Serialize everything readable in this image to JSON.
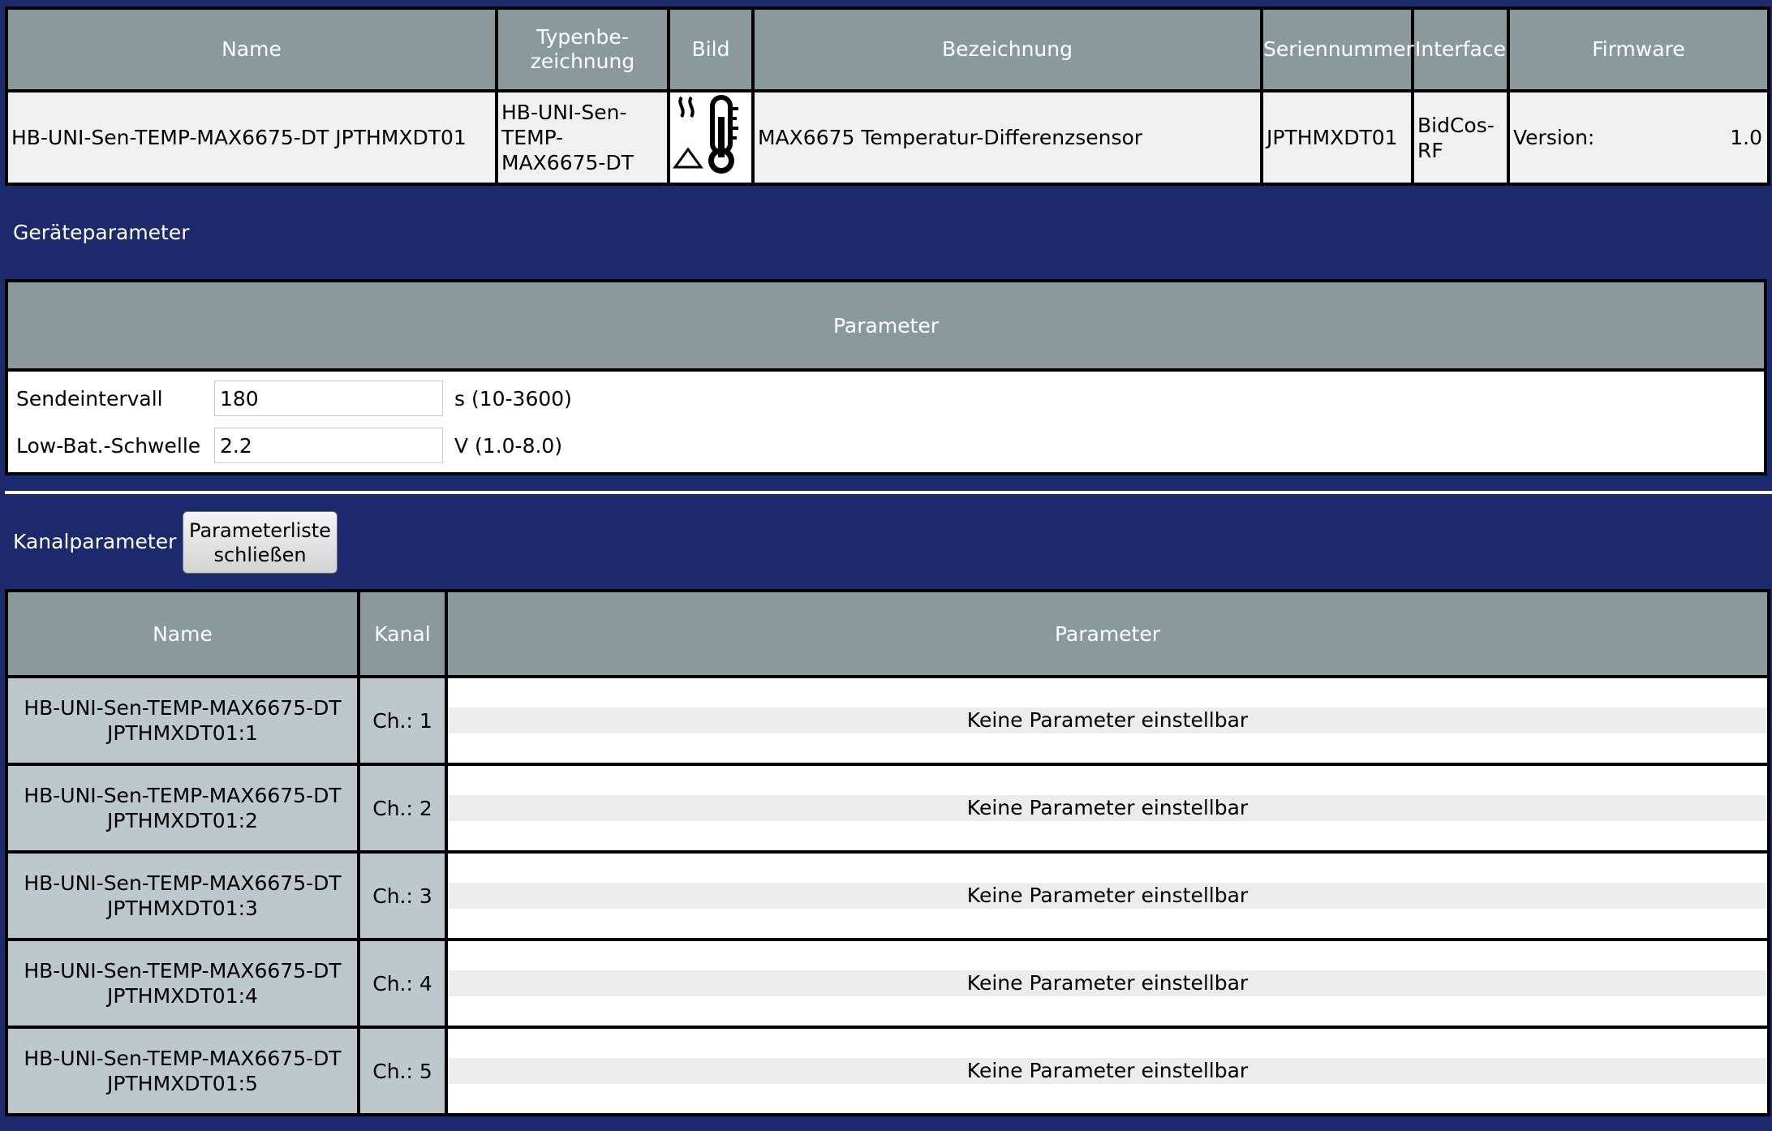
{
  "device": {
    "columns": {
      "name": "Name",
      "type": "Typenbe-\nzeichnung",
      "image": "Bild",
      "description": "Bezeichnung",
      "serial": "Seriennummer",
      "interface": "Interface",
      "firmware": "Firmware"
    },
    "row": {
      "name": "HB-UNI-Sen-TEMP-MAX6675-DT JPTHMXDT01",
      "type": "HB-UNI-Sen-TEMP-MAX6675-DT",
      "image_icon": "thermometer-heat-icon",
      "description": "MAX6675 Temperatur-Differenzsensor",
      "serial": "JPTHMXDT01",
      "interface": "BidCos-RF",
      "firmware_label": "Version:",
      "firmware_value": "1.0"
    }
  },
  "device_params": {
    "section_title": "Geräteparameter",
    "header": "Parameter",
    "rows": [
      {
        "label": "Sendeintervall",
        "value": "180",
        "unit": "s (10-3600)"
      },
      {
        "label": "Low-Bat.-Schwelle",
        "value": "2.2",
        "unit": "V (1.0-8.0)"
      }
    ]
  },
  "channel_params": {
    "section_title": "Kanalparameter",
    "close_button": "Parameterliste schließen",
    "columns": {
      "name": "Name",
      "channel": "Kanal",
      "parameter": "Parameter"
    },
    "rows": [
      {
        "name": "HB-UNI-Sen-TEMP-MAX6675-DT JPTHMXDT01:1",
        "channel": "Ch.: 1",
        "parameter": "Keine Parameter einstellbar"
      },
      {
        "name": "HB-UNI-Sen-TEMP-MAX6675-DT JPTHMXDT01:2",
        "channel": "Ch.: 2",
        "parameter": "Keine Parameter einstellbar"
      },
      {
        "name": "HB-UNI-Sen-TEMP-MAX6675-DT JPTHMXDT01:3",
        "channel": "Ch.: 3",
        "parameter": "Keine Parameter einstellbar"
      },
      {
        "name": "HB-UNI-Sen-TEMP-MAX6675-DT JPTHMXDT01:4",
        "channel": "Ch.: 4",
        "parameter": "Keine Parameter einstellbar"
      },
      {
        "name": "HB-UNI-Sen-TEMP-MAX6675-DT JPTHMXDT01:5",
        "channel": "Ch.: 5",
        "parameter": "Keine Parameter einstellbar"
      }
    ]
  }
}
